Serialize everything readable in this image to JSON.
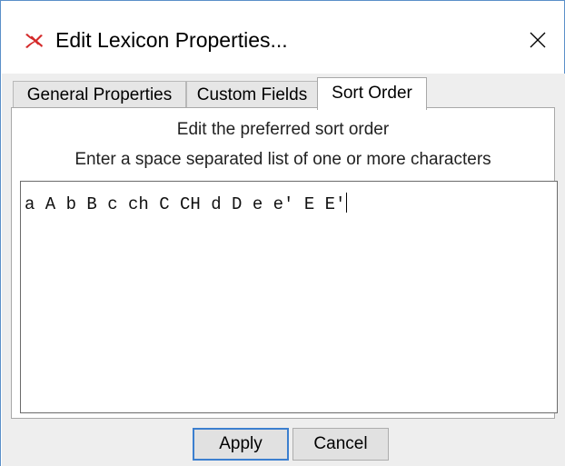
{
  "window": {
    "title": "Edit Lexicon Properties...",
    "app_icon": "app-logo-icon",
    "close_icon": "close-icon"
  },
  "tabs": [
    {
      "label": "General Properties",
      "active": false
    },
    {
      "label": "Custom Fields",
      "active": false
    },
    {
      "label": "Sort Order",
      "active": true
    }
  ],
  "panel": {
    "heading_1": "Edit the preferred sort order",
    "heading_2": "Enter a space separated list of one or more characters",
    "sort_order_value": "a A b B c ch C CH d D e e' E E'"
  },
  "buttons": {
    "apply_label": "Apply",
    "cancel_label": "Cancel"
  },
  "colors": {
    "app_icon_red": "#d42a2a",
    "focus_blue": "#3c7fcf",
    "window_border": "#5a8fc9"
  }
}
